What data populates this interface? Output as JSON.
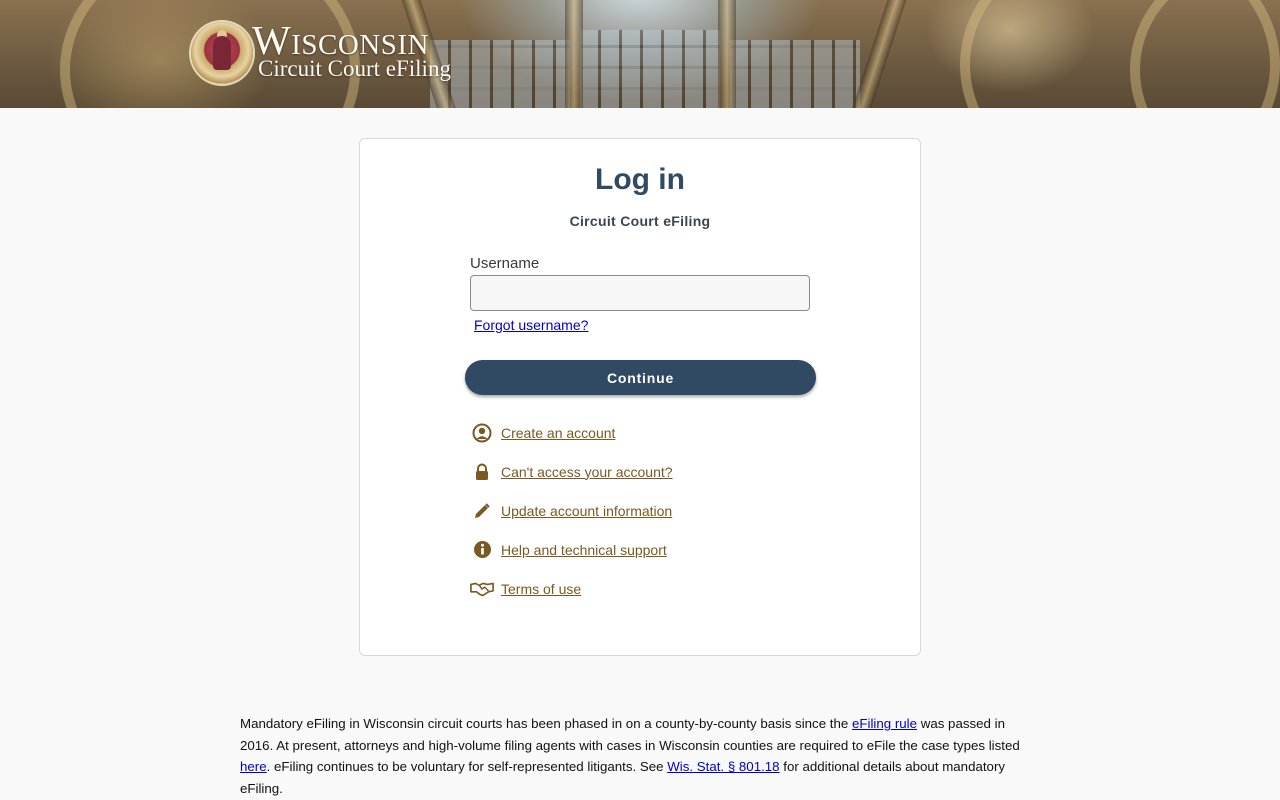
{
  "header": {
    "logo_title": "Wisconsin",
    "logo_subtitle": "Circuit Court eFiling"
  },
  "login": {
    "title": "Log in",
    "subtitle": "Circuit Court eFiling",
    "username_label": "Username",
    "username_value": "",
    "forgot_username": "Forgot username?",
    "continue_label": "Continue"
  },
  "links": [
    {
      "label": "Create an account",
      "icon": "user-circle-icon"
    },
    {
      "label": "Can't access your account?",
      "icon": "lock-icon"
    },
    {
      "label": "Update account information",
      "icon": "pencil-icon"
    },
    {
      "label": "Help and technical support",
      "icon": "info-icon"
    },
    {
      "label": "Terms of use",
      "icon": "handshake-icon"
    }
  ],
  "notice": {
    "part1": "Mandatory eFiling in Wisconsin circuit courts has been phased in on a county-by-county basis since the ",
    "link1": "eFiling rule",
    "part2": " was passed in 2016. At present, attorneys and high-volume filing agents with cases in Wisconsin counties are required to eFile the case types listed ",
    "link2": "here",
    "part3": ". eFiling continues to be voluntary for self-represented litigants. See ",
    "link3": "Wis. Stat. § 801.18",
    "part4": " for additional details about mandatory eFiling."
  },
  "colors": {
    "accent": "#2f4a62",
    "link_brown": "#7a5a22",
    "link_blue": "#0000cc"
  }
}
